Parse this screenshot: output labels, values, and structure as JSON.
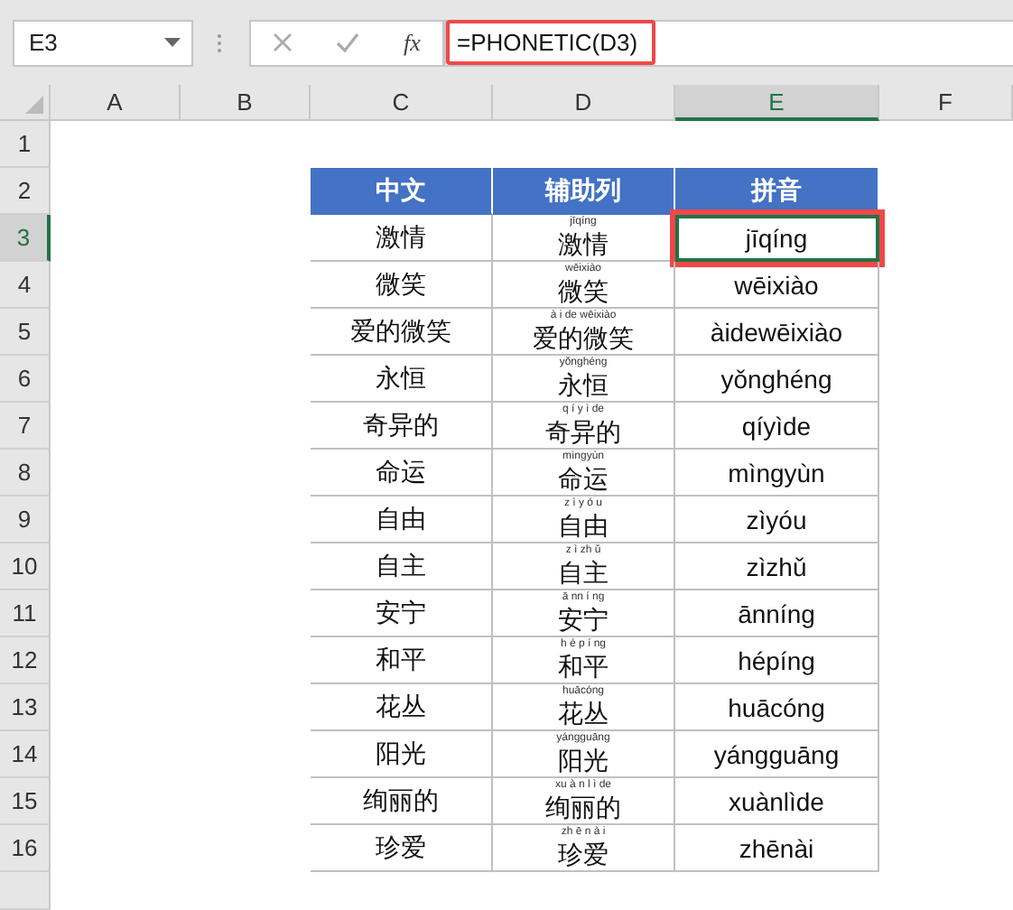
{
  "name_box": {
    "value": "E3"
  },
  "formula_bar": {
    "function_label": "fx",
    "formula": "=PHONETIC(D3)",
    "highlighted": true
  },
  "column_headers": [
    {
      "label": "A",
      "selected": false
    },
    {
      "label": "B",
      "selected": false
    },
    {
      "label": "C",
      "selected": false
    },
    {
      "label": "D",
      "selected": false
    },
    {
      "label": "E",
      "selected": true
    },
    {
      "label": "F",
      "selected": false
    }
  ],
  "row_headers": [
    {
      "label": "1",
      "selected": false
    },
    {
      "label": "2",
      "selected": false
    },
    {
      "label": "3",
      "selected": true
    },
    {
      "label": "4",
      "selected": false
    },
    {
      "label": "5",
      "selected": false
    },
    {
      "label": "6",
      "selected": false
    },
    {
      "label": "7",
      "selected": false
    },
    {
      "label": "8",
      "selected": false
    },
    {
      "label": "9",
      "selected": false
    },
    {
      "label": "10",
      "selected": false
    },
    {
      "label": "11",
      "selected": false
    },
    {
      "label": "12",
      "selected": false
    },
    {
      "label": "13",
      "selected": false
    },
    {
      "label": "14",
      "selected": false
    },
    {
      "label": "15",
      "selected": false
    },
    {
      "label": "16",
      "selected": false
    }
  ],
  "table": {
    "columns": [
      "中文",
      "辅助列",
      "拼音"
    ],
    "rows": [
      {
        "chinese": "激情",
        "phonetic_guide": "jīqíng",
        "helper": "激情",
        "pinyin": "jīqíng",
        "selected": true
      },
      {
        "chinese": "微笑",
        "phonetic_guide": "wēixiào",
        "helper": "微笑",
        "pinyin": "wēixiào",
        "selected": false
      },
      {
        "chinese": "爱的微笑",
        "phonetic_guide": "à i de wēixiào",
        "helper": "爱的微笑",
        "pinyin": "àidewēixiào",
        "selected": false
      },
      {
        "chinese": "永恒",
        "phonetic_guide": "yǒnghéng",
        "helper": "永恒",
        "pinyin": "yǒnghéng",
        "selected": false
      },
      {
        "chinese": "奇异的",
        "phonetic_guide": "q í y ì de",
        "helper": "奇异的",
        "pinyin": "qíyìde",
        "selected": false
      },
      {
        "chinese": "命运",
        "phonetic_guide": "mìngyùn",
        "helper": "命运",
        "pinyin": "mìngyùn",
        "selected": false
      },
      {
        "chinese": "自由",
        "phonetic_guide": "z ì y ó u",
        "helper": "自由",
        "pinyin": "zìyóu",
        "selected": false
      },
      {
        "chinese": "自主",
        "phonetic_guide": "z ì zh ǔ",
        "helper": "自主",
        "pinyin": "zìzhǔ",
        "selected": false
      },
      {
        "chinese": "安宁",
        "phonetic_guide": "ā nn í ng",
        "helper": "安宁",
        "pinyin": "ānníng",
        "selected": false
      },
      {
        "chinese": "和平",
        "phonetic_guide": "h é p í ng",
        "helper": "和平",
        "pinyin": "hépíng",
        "selected": false
      },
      {
        "chinese": "花丛",
        "phonetic_guide": "huācóng",
        "helper": "花丛",
        "pinyin": "huācóng",
        "selected": false
      },
      {
        "chinese": "阳光",
        "phonetic_guide": "yángguāng",
        "helper": "阳光",
        "pinyin": "yángguāng",
        "selected": false
      },
      {
        "chinese": "绚丽的",
        "phonetic_guide": "xu à n l ì de",
        "helper": "绚丽的",
        "pinyin": "xuànlìde",
        "selected": false
      },
      {
        "chinese": "珍爱",
        "phonetic_guide": "zh ē n à i",
        "helper": "珍爱",
        "pinyin": "zhēnài",
        "selected": false
      }
    ]
  }
}
